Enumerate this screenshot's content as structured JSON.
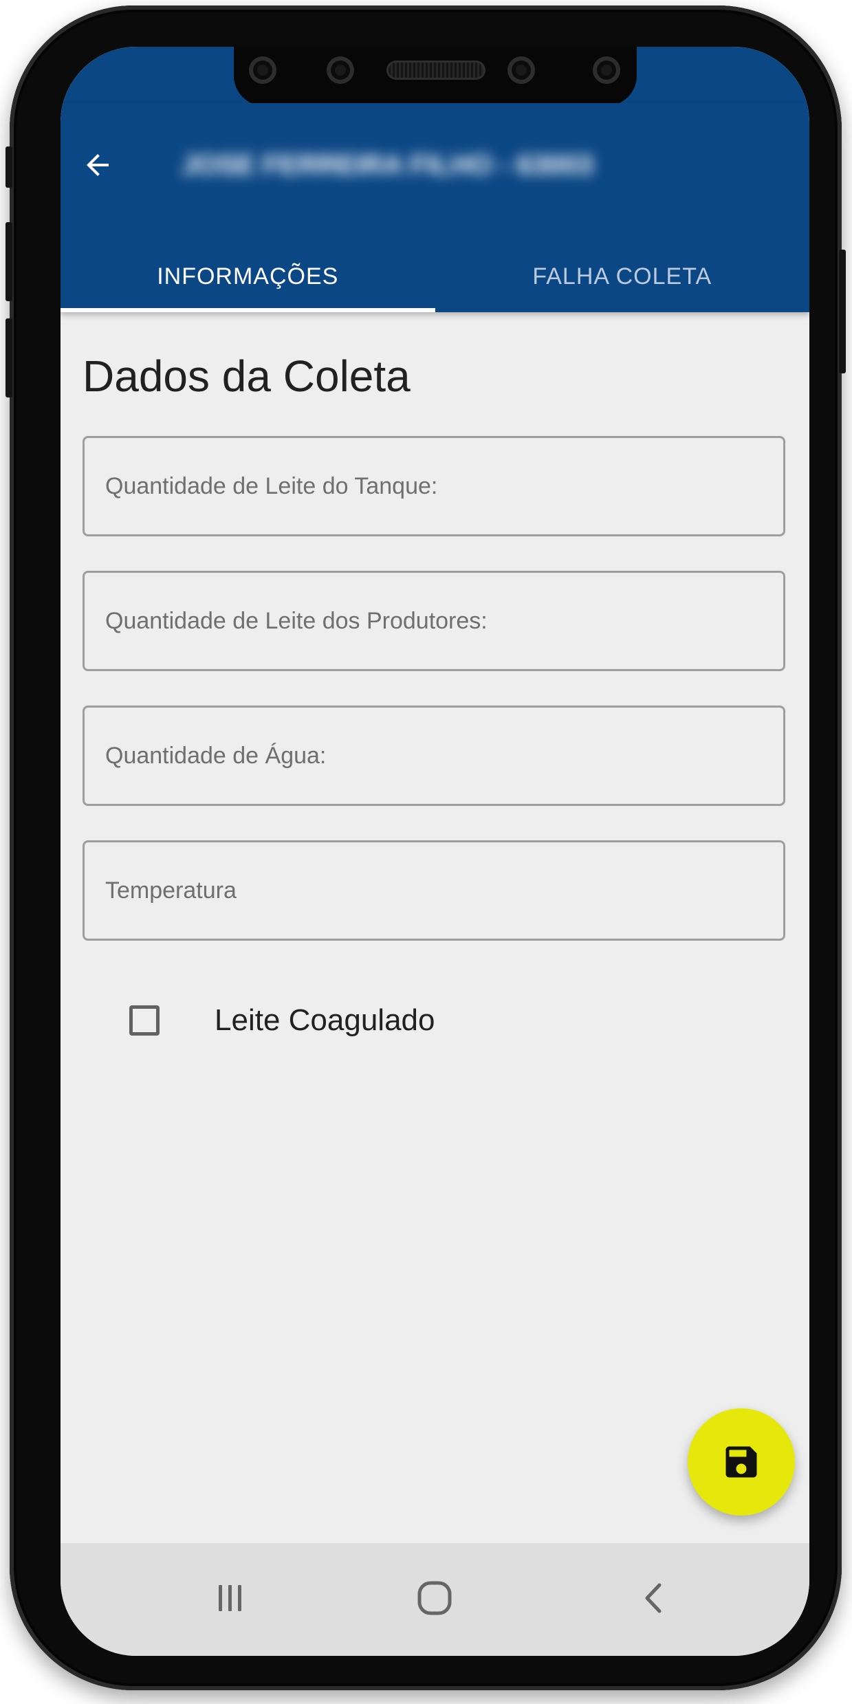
{
  "appbar": {
    "back_icon": "arrow-left-icon",
    "title": "JOSE FERREIRA FILHO - 63003",
    "color": "#0c4785"
  },
  "tabs": [
    {
      "label": "INFORMAÇÕES",
      "active": true
    },
    {
      "label": "FALHA COLETA",
      "active": false
    }
  ],
  "form": {
    "title": "Dados da Coleta",
    "fields": [
      {
        "placeholder": "Quantidade de Leite do Tanque:",
        "value": ""
      },
      {
        "placeholder": "Quantidade de Leite dos Produtores:",
        "value": ""
      },
      {
        "placeholder": "Quantidade de Água:",
        "value": ""
      },
      {
        "placeholder": "Temperatura",
        "value": ""
      }
    ],
    "checkbox": {
      "label": "Leite Coagulado",
      "checked": false
    }
  },
  "fab": {
    "icon": "floppy-disk-icon",
    "color": "#e6e80b"
  },
  "system_nav": {
    "recents_icon": "recent-apps-icon",
    "home_icon": "home-icon",
    "back_icon": "back-chevron-icon"
  }
}
